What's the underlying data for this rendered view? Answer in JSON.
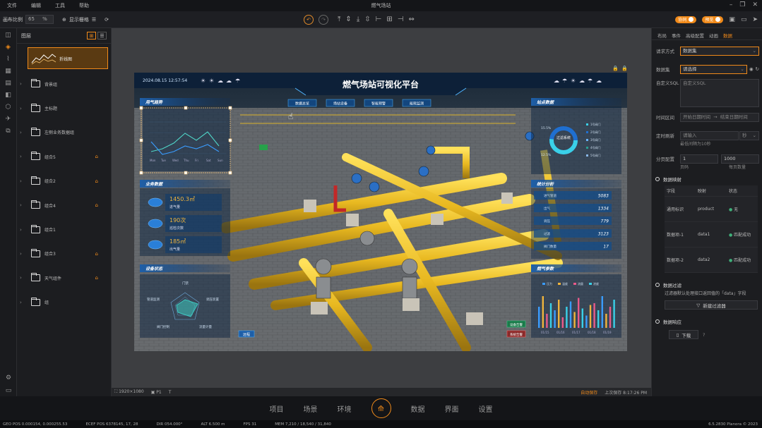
{
  "app": {
    "title": "燃气场站",
    "menu": [
      "文件",
      "编辑",
      "工具",
      "帮助"
    ]
  },
  "toolbar": {
    "grid_label": "画布比例",
    "zoom_value": "65",
    "zoom_unit": "%",
    "grid_toggle": "显示栅格"
  },
  "toggles": [
    {
      "label": "协同"
    },
    {
      "label": "预览"
    }
  ],
  "layers": {
    "title": "图层",
    "selected": {
      "label": "折线图"
    },
    "items": [
      {
        "label": "背景组",
        "locked": false
      },
      {
        "label": "主标题",
        "locked": false
      },
      {
        "label": "左侧业务数据组",
        "locked": false
      },
      {
        "label": "组合5",
        "locked": true
      },
      {
        "label": "组合2",
        "locked": true
      },
      {
        "label": "组合4",
        "locked": true
      },
      {
        "label": "组合1",
        "locked": false
      },
      {
        "label": "组合3",
        "locked": true
      },
      {
        "label": "天气组件",
        "locked": true
      },
      {
        "label": "组",
        "locked": false
      }
    ]
  },
  "dashboard": {
    "title": "燃气场站可视化平台",
    "datetime": "2024.08.15 12:57:54",
    "nav_buttons": [
      "数据总览",
      "场站设备",
      "智能预警",
      "能耗监测"
    ],
    "panel_titles": {
      "trend": "用气趋势",
      "business": "业务数据",
      "device": "设备状态",
      "site": "站点数据",
      "stats": "统计分析",
      "gas": "燃气参数"
    },
    "trend_xlabels": [
      "Mon",
      "Tue",
      "Wed",
      "Thu",
      "Fri",
      "Sat",
      "Sun"
    ],
    "business": [
      {
        "value": "1450.3㎡",
        "label": "进气量"
      },
      {
        "value": "190次",
        "label": "巡检次数"
      },
      {
        "value": "185㎡",
        "label": "出气量"
      }
    ],
    "device_labels": [
      "门禁",
      "调压装置",
      "流量计量",
      "阀门控制",
      "管道监测"
    ],
    "donut": {
      "center": "过滤系统",
      "pct_a": "15.5%",
      "pct_b": "12.5%",
      "legend": [
        "1号阀门",
        "2号阀门",
        "3号阀门",
        "4号阀门",
        "5号阀门"
      ]
    },
    "stat_rows": [
      {
        "label": "进气管道",
        "value": "5083"
      },
      {
        "label": "出气",
        "value": "1334"
      },
      {
        "label": "调压",
        "value": "779"
      },
      {
        "label": "过滤",
        "value": "3123"
      },
      {
        "label": "阀门数量",
        "value": "17"
      }
    ],
    "gas_legend": [
      "压力",
      "温度",
      "流量",
      "浓度"
    ],
    "gas_xlabels": [
      "01/15",
      "01/16",
      "01/17",
      "01/18",
      "01/19"
    ],
    "bottom_tag": "远程",
    "alerts": [
      "设备告警",
      "系统告警"
    ]
  },
  "status_line": {
    "resolution": "1920×1080",
    "page": "P1",
    "zoom": "T",
    "save_state": "自动保存",
    "time": "上次保存 8:17:26 PM"
  },
  "bottom_nav": [
    "项目",
    "场景",
    "环境",
    "数据",
    "界面",
    "设置"
  ],
  "stats_bar": [
    "GEO POS  0.000154, 0.000255.53",
    "ECEF POS  6378145, 17, 28",
    "DIR  054.000°",
    "ALT  6.500 m",
    "FPS  31",
    "MEM  7,210 / 18,540 / 31,840",
    "6.5.2830  Planora © 2023"
  ],
  "props": {
    "tabs": [
      "布局",
      "事件",
      "高级配置",
      "动画",
      "数据"
    ],
    "active_tab": 4,
    "request_label": "请求方式",
    "request_value": "数据集",
    "dataset_label": "数据集",
    "dataset_value": "请选择",
    "sql_label": "自定义SQL",
    "sql_placeholder": "自定义SQL",
    "time_label": "时间区间",
    "time_start": "开始日期时间",
    "time_end": "结束日期时间",
    "refresh_label": "定时刷新",
    "refresh_placeholder": "请输入",
    "refresh_unit": "秒",
    "refresh_hint": "最低间隔为10秒",
    "page_label": "分页配置",
    "page_num": "1",
    "page_size": "1000",
    "page_num_caption": "页码",
    "page_size_caption": "每页数量",
    "mapping_section": "数据映射",
    "mapping_head": [
      "字段",
      "映射",
      "状态"
    ],
    "mapping_rows": [
      {
        "field": "通用标识",
        "map": "product",
        "state": "无"
      },
      {
        "field": "数据项-1",
        "map": "data1",
        "state": "匹配成功"
      },
      {
        "field": "数据项-2",
        "map": "data2",
        "state": "匹配成功"
      }
    ],
    "filter_section": "数据过滤",
    "filter_desc": "过滤器默认处理接口返回值的「data」字段",
    "add_filter": "新建过滤器",
    "response_section": "数据响应",
    "download": "下载"
  }
}
